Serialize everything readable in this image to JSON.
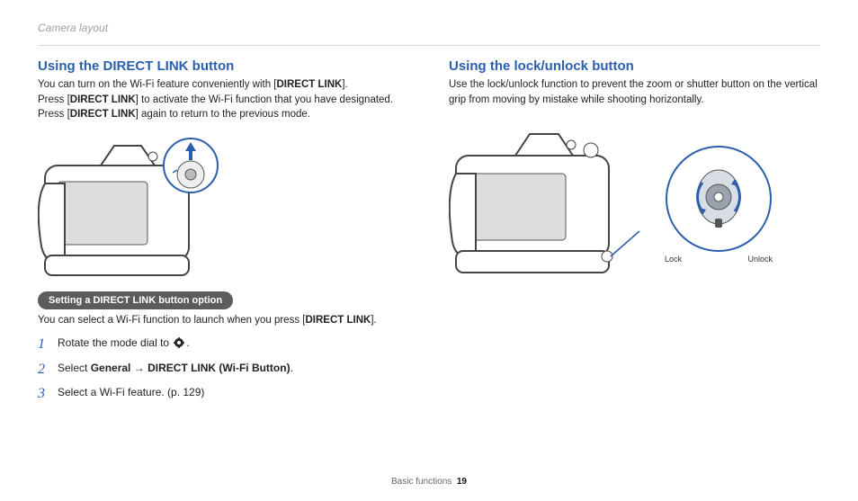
{
  "header": {
    "section": "Camera layout"
  },
  "left": {
    "heading": "Using the DIRECT LINK button",
    "intro_parts": [
      "You can turn on the Wi-Fi feature conveniently with [",
      "].",
      "Press [",
      "] to activate the Wi-Fi function that you have designated. Press [",
      "] again to return to the previous mode."
    ],
    "direct_link_label": "DIRECT LINK",
    "pill": "Setting a DIRECT LINK button option",
    "pill_text_parts": [
      "You can select a Wi-Fi function to launch when you press [",
      "]."
    ],
    "steps": {
      "s1_prefix": "Rotate the mode dial to ",
      "s1_suffix": ".",
      "s2_prefix": "Select ",
      "s2_bold1": "General",
      "s2_arrow": " → ",
      "s2_bold2": "DIRECT LINK (Wi-Fi Button)",
      "s2_suffix": ".",
      "s3": "Select a Wi-Fi feature. (p. 129)"
    }
  },
  "right": {
    "heading": "Using the lock/unlock button",
    "intro": "Use the lock/unlock function to prevent the zoom or shutter button on the vertical grip from moving by mistake while shooting horizontally.",
    "lock_label": "Lock",
    "unlock_label": "Unlock"
  },
  "footer": {
    "chapter": "Basic functions",
    "page": "19"
  }
}
